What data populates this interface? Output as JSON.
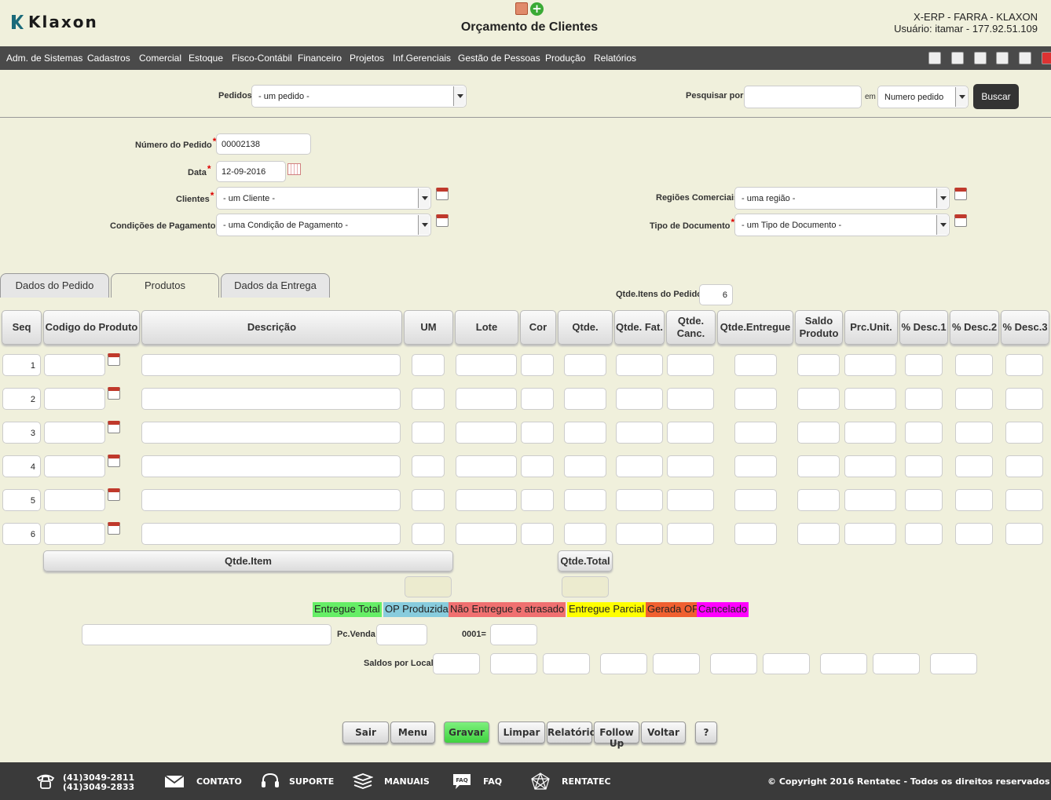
{
  "header": {
    "brand": "Klaxon",
    "title": "Orçamento de Clientes",
    "system": "X-ERP - FARRA - KLAXON",
    "user": "Usuário: itamar - 177.92.51.109"
  },
  "menu": [
    "Adm. de Sistemas",
    "Cadastros",
    "Comercial",
    "Estoque",
    "Fisco-Contábil",
    "Financeiro",
    "Projetos",
    "Inf.Gerenciais",
    "Gestão de Pessoas",
    "Produção",
    "Relatórios"
  ],
  "search": {
    "pedidos_label": "Pedidos",
    "pedidos_value": "- um pedido -",
    "pesquisar_label": "Pesquisar por:",
    "pesquisar_value": "",
    "em_label": "em",
    "em_value": "Numero pedido",
    "buscar": "Buscar"
  },
  "form": {
    "numero_label": "Número do Pedido",
    "numero_value": "00002138",
    "data_label": "Data",
    "data_value": "12-09-2016",
    "clientes_label": "Clientes",
    "clientes_value": "- um Cliente -",
    "condicoes_label": "Condições de Pagamento",
    "condicoes_value": "- uma Condição de Pagamento -",
    "regioes_label": "Regiões Comerciais",
    "regioes_value": "- uma região -",
    "tipo_label": "Tipo de Documento",
    "tipo_value": "- um Tipo de Documento -"
  },
  "tabs": [
    "Dados do Pedido",
    "Produtos",
    "Dados da Entrega"
  ],
  "qtde_itens": {
    "label": "Qtde.Itens do Pedido",
    "value": "6"
  },
  "grid": {
    "headers": [
      "Seq",
      "Codigo do Produto",
      "Descrição",
      "UM",
      "Lote",
      "Cor",
      "Qtde.",
      "Qtde. Fat.",
      "Qtde. Canc.",
      "Qtde.Entregue",
      "Saldo Produto",
      "Prc.Unit.",
      "% Desc.1",
      "% Desc.2",
      "% Desc.3"
    ],
    "seq": [
      "1",
      "2",
      "3",
      "4",
      "5",
      "6"
    ]
  },
  "totals": {
    "qtde_item": "Qtde.Item",
    "qtde_total": "Qtde.Total"
  },
  "legend": [
    {
      "label": "Entregue Total",
      "color": "#66ee66"
    },
    {
      "label": "OP Produzida",
      "color": "#88ccdd"
    },
    {
      "label": "Não Entregue e atrasado",
      "color": "#f07070"
    },
    {
      "label": "Entregue Parcial",
      "color": "#ffff00"
    },
    {
      "label": "Gerada OP",
      "color": "#f06030"
    },
    {
      "label": "Cancelado",
      "color": "#ff00ff"
    }
  ],
  "extra": {
    "pcvenda_label": "Pc.Venda",
    "code_label": "0001=",
    "saldos_label": "Saldos por Local"
  },
  "buttons": [
    "Sair",
    "Menu",
    "Gravar",
    "Limpar",
    "Relatório",
    "Follow Up",
    "Voltar",
    "?"
  ],
  "footer": {
    "phone1": "(41)3049-2811",
    "phone2": "(41)3049-2833",
    "contato": "CONTATO",
    "suporte": "SUPORTE",
    "manuais": "MANUAIS",
    "faq": "FAQ",
    "faq_icon_text": "FAQ",
    "rentatec": "RENTATEC",
    "copyright": "© Copyright 2016 Rentatec - Todos os direitos reservados"
  }
}
